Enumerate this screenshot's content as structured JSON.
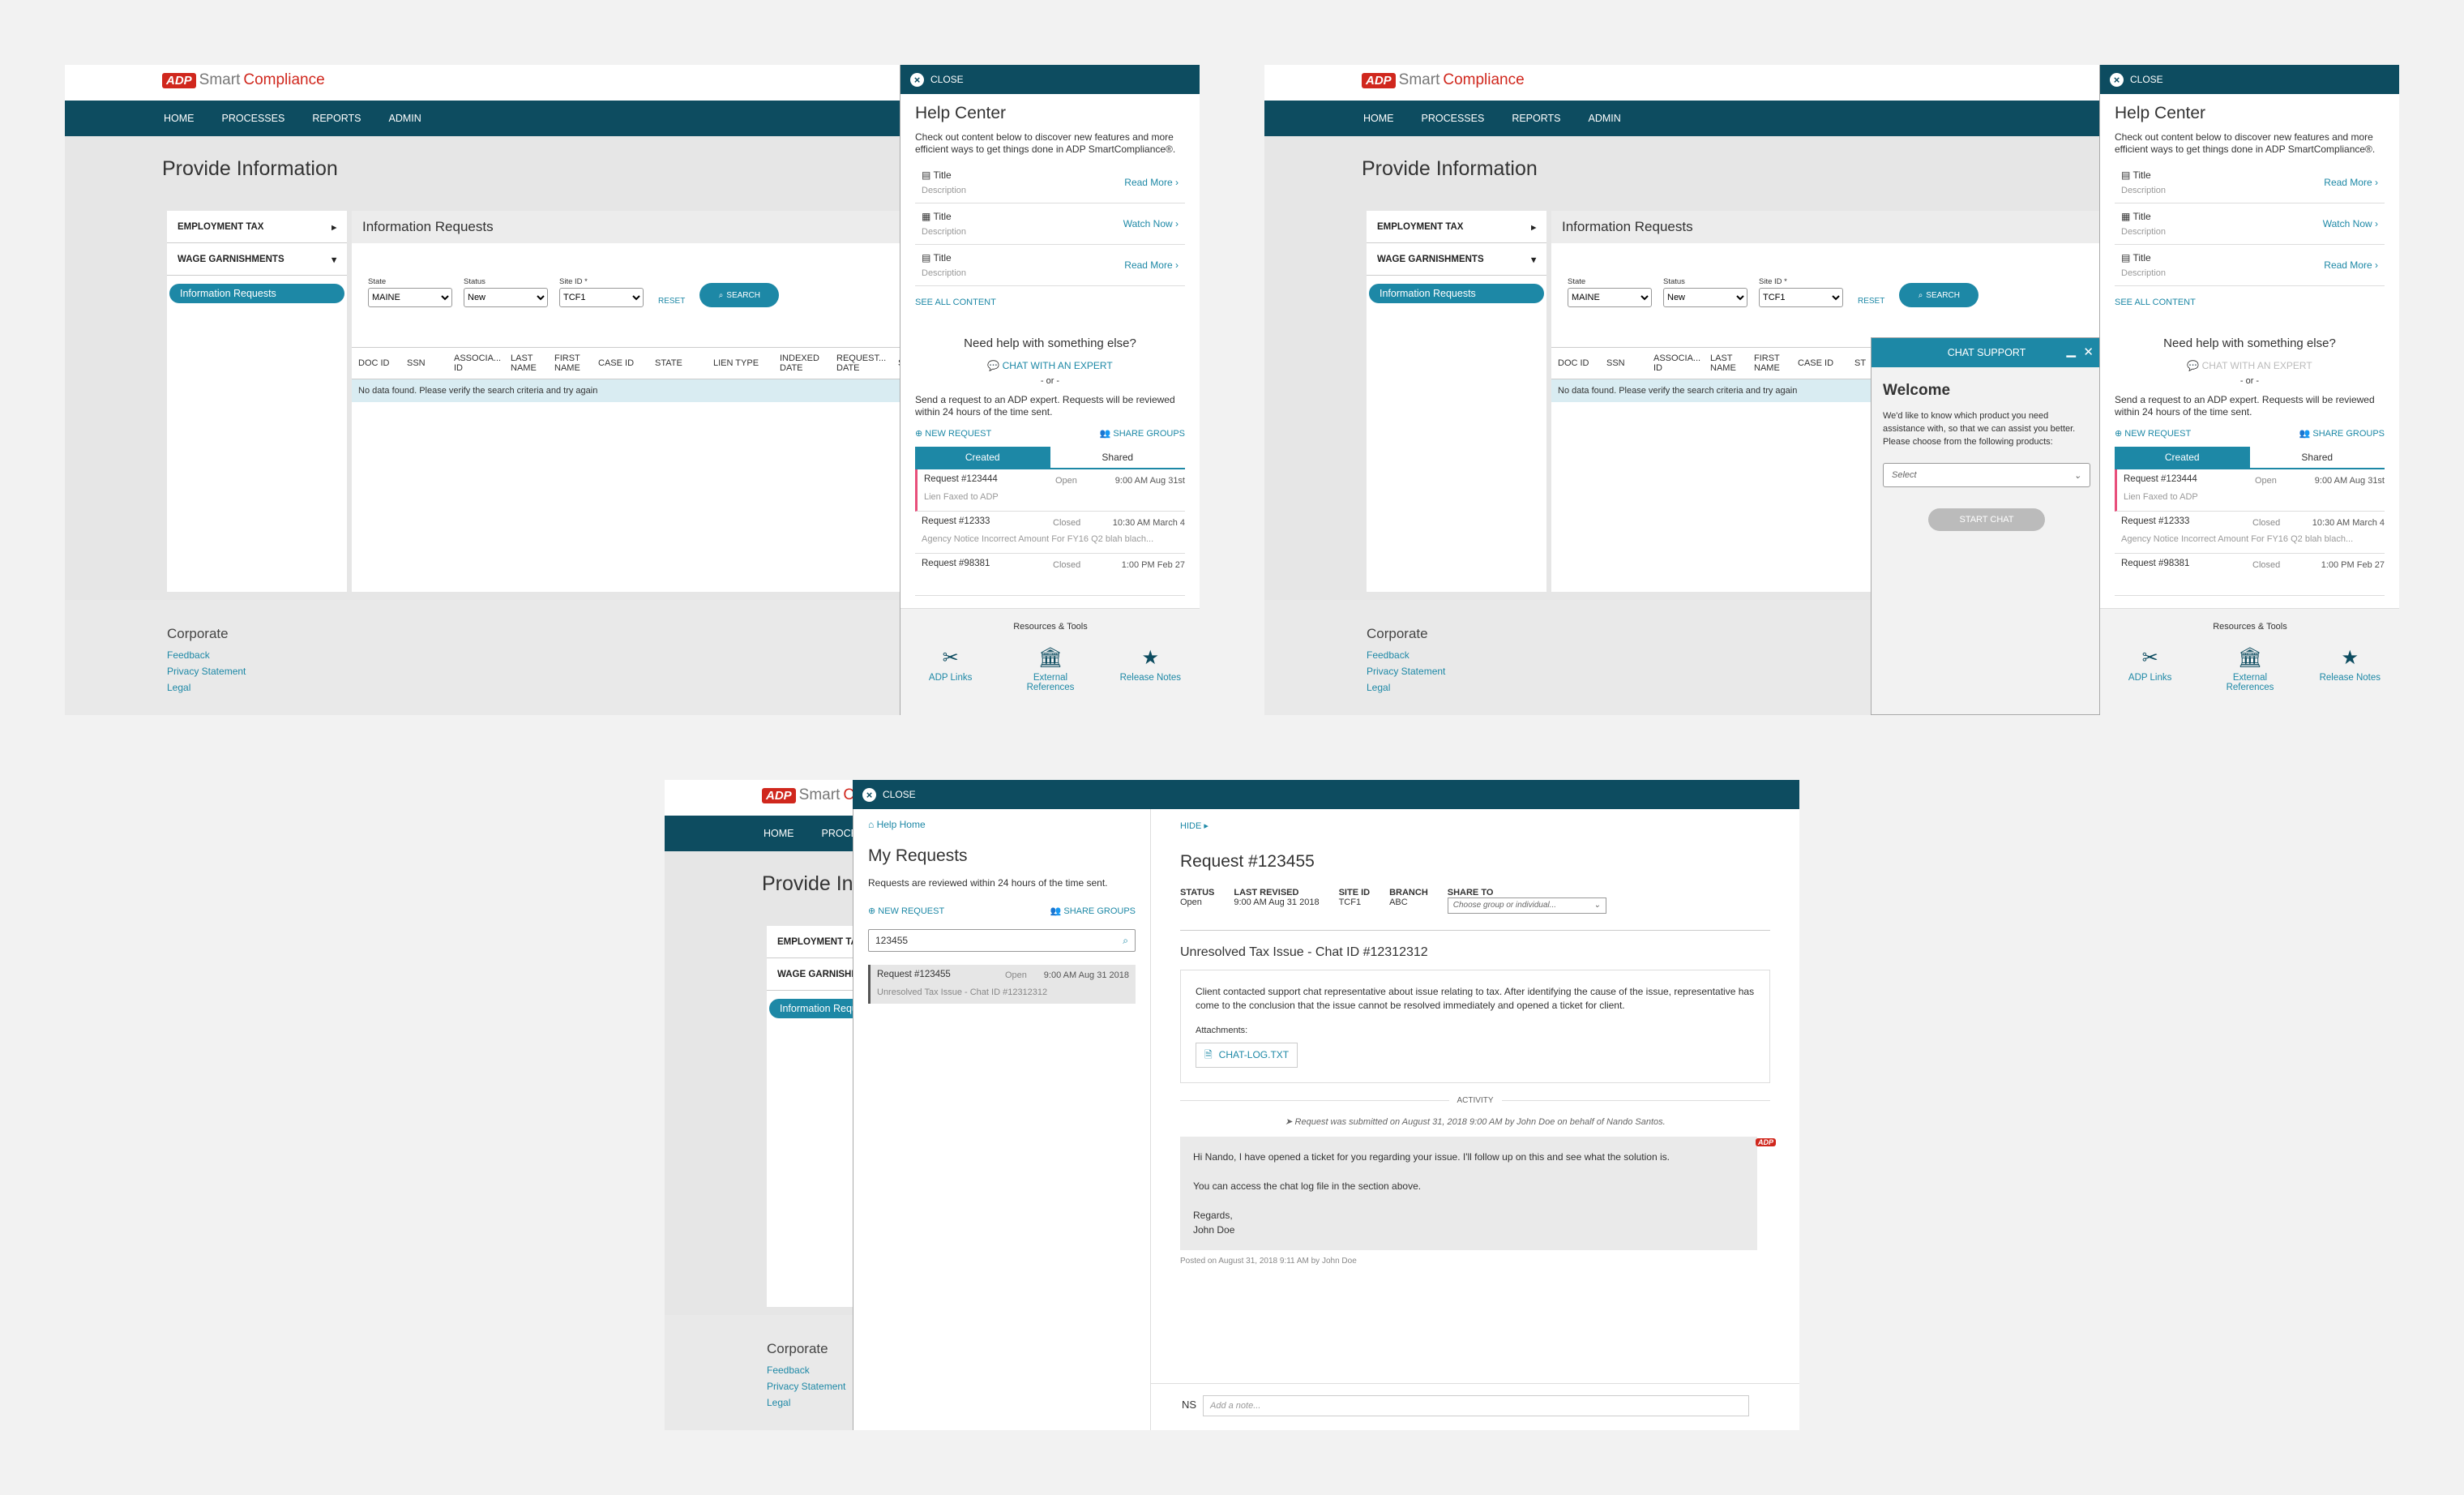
{
  "app": {
    "logo_mark": "ADP",
    "logo_a": "Smart",
    "logo_b": "Compliance"
  },
  "nav": [
    "HOME",
    "PROCESSES",
    "REPORTS",
    "ADMIN"
  ],
  "page_title": "Provide Information",
  "sidebar": {
    "employment_tax": "EMPLOYMENT TAX",
    "wage_garnishments": "WAGE GARNISHMENTS",
    "info_requests": "Information Requests"
  },
  "content": {
    "title": "Information Requests",
    "filters": {
      "state_label": "State",
      "state_value": "MAINE",
      "status_label": "Status",
      "status_value": "New",
      "site_label": "Site ID *",
      "site_value": "TCF1",
      "reset": "RESET",
      "search": "SEARCH"
    },
    "columns": [
      "DOC ID",
      "SSN",
      "ASSOCIA... ID",
      "LAST NAME",
      "FIRST NAME",
      "CASE ID",
      "STATE",
      "LIEN TYPE",
      "INDEXED DATE",
      "REQUEST... DATE",
      "ST"
    ],
    "no_data": "No data found. Please verify the search criteria and try again"
  },
  "footer": {
    "title": "Corporate",
    "links": [
      "Feedback",
      "Privacy Statement",
      "Legal"
    ]
  },
  "help": {
    "close": "CLOSE",
    "title": "Help Center",
    "desc": "Check out content below to discover new features and more efficient ways to get things done in ADP SmartCompliance®.",
    "items": [
      {
        "title": "Title",
        "desc": "Description",
        "action": "Read More"
      },
      {
        "title": "Title",
        "desc": "Description",
        "action": "Watch Now"
      },
      {
        "title": "Title",
        "desc": "Description",
        "action": "Read More"
      }
    ],
    "see_all": "SEE ALL CONTENT",
    "need_help": "Need help with something else?",
    "chat_expert": "CHAT WITH AN EXPERT",
    "or": "- or -",
    "send_req": "Send a request to an ADP expert. Requests will be reviewed within 24 hours of the time sent.",
    "new_request": "NEW REQUEST",
    "share_groups": "SHARE GROUPS",
    "tabs": [
      "Created",
      "Shared"
    ],
    "requests": [
      {
        "id": "Request #123444",
        "status": "Open",
        "date": "9:00 AM Aug 31st",
        "desc": "Lien Faxed to ADP"
      },
      {
        "id": "Request #12333",
        "status": "Closed",
        "date": "10:30 AM March 4",
        "desc": "Agency Notice Incorrect Amount For FY16 Q2 blah blach..."
      },
      {
        "id": "Request #98381",
        "status": "Closed",
        "date": "1:00 PM Feb 27",
        "desc": ""
      }
    ],
    "resources_title": "Resources & Tools",
    "tools": [
      "ADP Links",
      "External References",
      "Release Notes"
    ]
  },
  "chat": {
    "title": "CHAT SUPPORT",
    "welcome": "Welcome",
    "desc": "We'd like to know which product you need assistance with, so that we can assist you better. Please choose from the following products:",
    "select": "Select",
    "start": "START CHAT"
  },
  "myreq": {
    "help_home": "Help Home",
    "title": "My Requests",
    "desc": "Requests are reviewed within 24 hours of the time sent.",
    "new_request": "NEW REQUEST",
    "share_groups": "SHARE GROUPS",
    "search_value": "123455",
    "item": {
      "id": "Request #123455",
      "status": "Open",
      "date": "9:00 AM Aug 31 2018",
      "desc": "Unresolved Tax Issue - Chat ID #12312312"
    }
  },
  "detail": {
    "hide": "HIDE",
    "title": "Request #123455",
    "meta": [
      {
        "label": "STATUS",
        "value": "Open"
      },
      {
        "label": "LAST REVISED",
        "value": "9:00 AM Aug 31 2018"
      },
      {
        "label": "SITE ID",
        "value": "TCF1"
      },
      {
        "label": "BRANCH",
        "value": "ABC"
      }
    ],
    "share_label": "SHARE TO",
    "share_placeholder": "Choose group or individual...",
    "subject": "Unresolved Tax Issue - Chat ID #12312312",
    "body": "Client contacted support chat representative about issue relating to tax. After identifying the cause of the issue, representative has come to the conclusion that the issue cannot be resolved immediately and opened a ticket for client.",
    "attachments_label": "Attachments:",
    "attachment": "CHAT-LOG.TXT",
    "activity": "ACTIVITY",
    "submitted": "Request was submitted on August 31, 2018 9:00 AM by John Doe on behalf of Nando Santos.",
    "msg1": "Hi Nando, I have opened a ticket for you regarding your issue. I'll follow up on this and see what the solution is.",
    "msg2": "You can access the chat log file in the section above.",
    "msg3": "Regards,",
    "msg4": "John Doe",
    "posted": "Posted on August 31, 2018 9:11 AM by John Doe",
    "initials": "NS",
    "note_placeholder": "Add a note..."
  }
}
